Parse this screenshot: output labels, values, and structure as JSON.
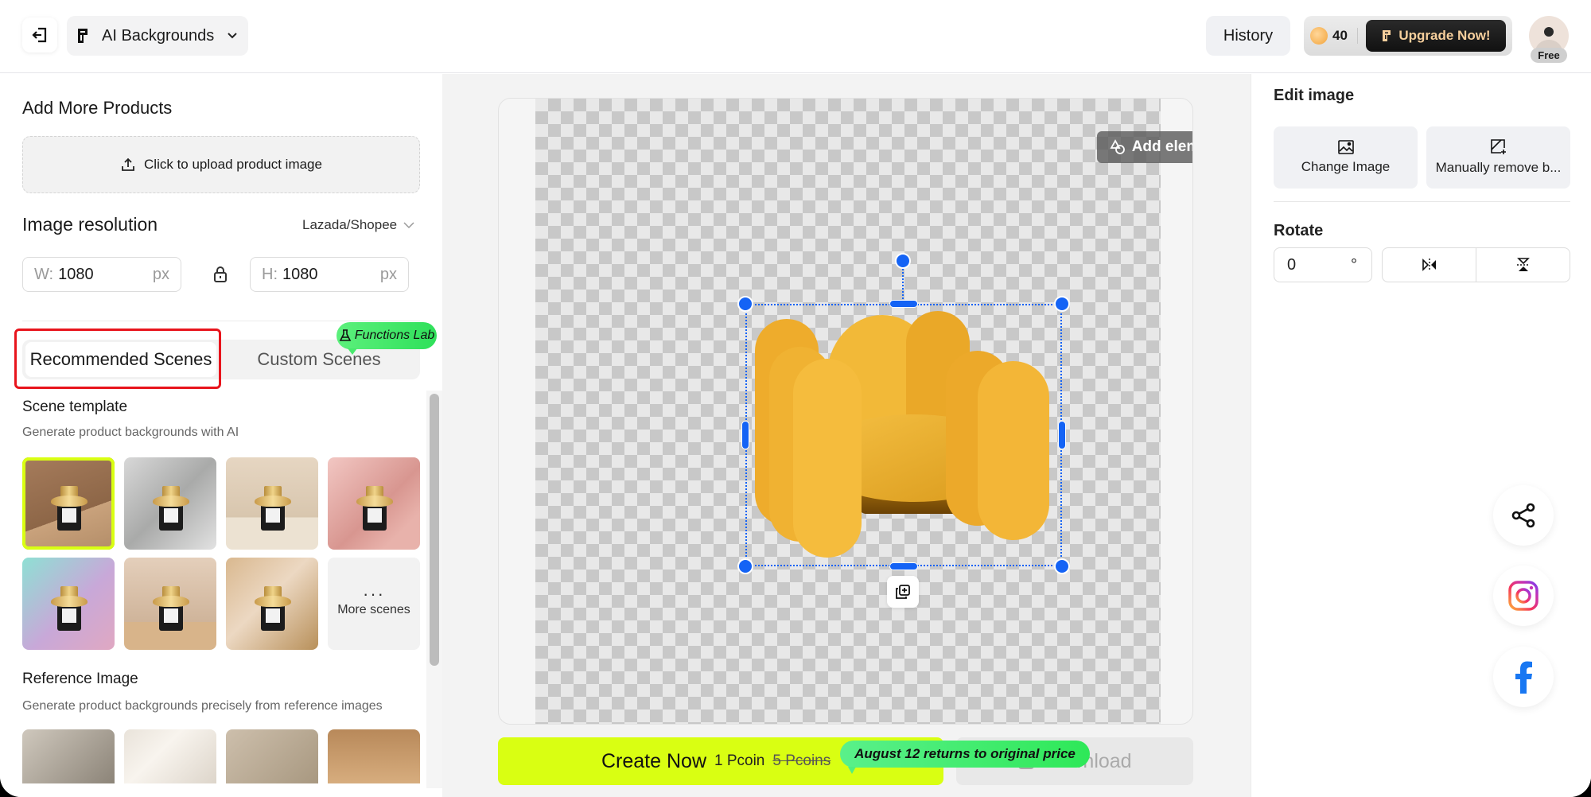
{
  "header": {
    "tool_name": "AI Backgrounds",
    "history_label": "History",
    "coin_count": "40",
    "upgrade_label": "Upgrade Now!",
    "plan_badge": "Free"
  },
  "left_panel": {
    "add_products_title": "Add More Products",
    "upload_label": "Click to upload product image",
    "resolution_title": "Image resolution",
    "preset_value": "Lazada/Shopee",
    "width": {
      "prefix": "W:",
      "value": "1080",
      "unit": "px"
    },
    "height": {
      "prefix": "H:",
      "value": "1080",
      "unit": "px"
    },
    "tabs": [
      {
        "label": "Recommended Scenes",
        "active": true
      },
      {
        "label": "Custom Scenes",
        "active": false
      }
    ],
    "lab_badge": "Functions Lab",
    "scene_template": {
      "title": "Scene template",
      "subtitle": "Generate product backgrounds with AI",
      "thumbnails": [
        {
          "name": "brown-wood",
          "selected": true,
          "bg": "linear-gradient(160deg,#a67c5c,#8d6647 60%,#c9a27c 60%,#b38d68)"
        },
        {
          "name": "grey-pedestal-plants",
          "selected": false,
          "bg": "linear-gradient(135deg,#d8d8d8,#a9aaa9 50%,#e2e2e2)"
        },
        {
          "name": "cream-flowers",
          "selected": false,
          "bg": "linear-gradient(180deg,#e6d6c2,#d8c6ae 65%,#ece2d2 65%)"
        },
        {
          "name": "pink-shadow",
          "selected": false,
          "bg": "linear-gradient(135deg,#f2c7c3,#d89690 55%,#e8b2ab 80%)"
        },
        {
          "name": "pastel-teal-podium",
          "selected": false,
          "bg": "linear-gradient(135deg,#8ee0d4,#c8a8d8 55%,#e0a8c2)"
        },
        {
          "name": "beige-shelf",
          "selected": false,
          "bg": "linear-gradient(180deg,#e4cfbb,#cfb49a 70%,#d8b48a 70%)"
        },
        {
          "name": "roses",
          "selected": false,
          "bg": "linear-gradient(135deg,#d9b88f,#ecd8c2 45%,#b8905a)"
        }
      ],
      "more_label": "More scenes",
      "more_icon": "ellipsis"
    },
    "reference_image": {
      "title": "Reference Image",
      "subtitle": "Generate product backgrounds precisely from reference images",
      "thumbnails": [
        {
          "name": "grey-wall-cutting-board",
          "bg": "linear-gradient(135deg,#cfc8bd,#8c8478)"
        },
        {
          "name": "light-shadows",
          "bg": "linear-gradient(135deg,#e9e3da,#f8f4ee 40%,#ddd5ca)"
        },
        {
          "name": "beige-branch",
          "bg": "linear-gradient(135deg,#cdbfac,#a89880)"
        },
        {
          "name": "tan-gradient",
          "bg": "linear-gradient(180deg,#b8895a,#d7ad7e)"
        }
      ]
    }
  },
  "canvas": {
    "add_elements_label": "Add elements",
    "product": "yellow armchair",
    "create_label": "Create Now",
    "price": "1 Pcoin",
    "old_price": "5 Pcoins",
    "promo": "August 12 returns to original price",
    "download_label": "Download"
  },
  "right_panel": {
    "edit_title": "Edit image",
    "change_image_label": "Change Image",
    "manual_remove_label": "Manually remove b...",
    "rotate_title": "Rotate",
    "rotate_value": "0",
    "rotate_unit": "°"
  },
  "colors": {
    "accent_lime": "#d9ff12",
    "selection_blue": "#1463f5",
    "highlight_red": "#e8141c",
    "promo_green": "#2ee858",
    "facebook_blue": "#1877f2"
  }
}
